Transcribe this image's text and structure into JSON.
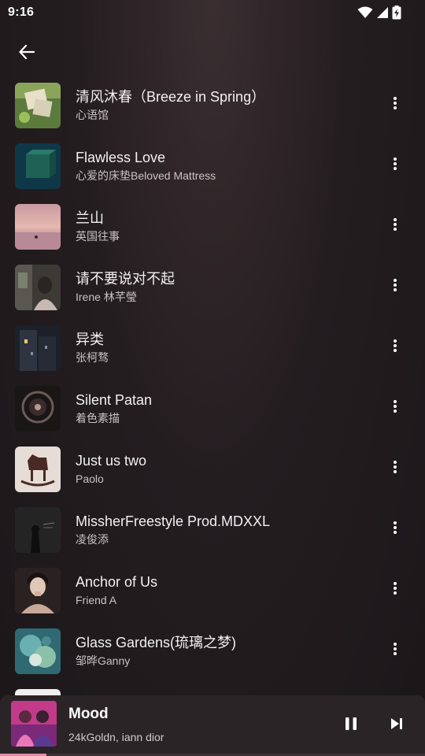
{
  "status_bar": {
    "time": "9:16"
  },
  "header": {
    "back_icon": "arrow-left-icon"
  },
  "songs": [
    {
      "title": "清风沐春（Breeze in Spring）",
      "artist": "心语馆",
      "cover": "cover-green-frames"
    },
    {
      "title": "Flawless Love",
      "artist": "心爱的床垫Beloved Mattress",
      "cover": "cover-teal-box"
    },
    {
      "title": "兰山",
      "artist": "英国往事",
      "cover": "cover-pink-sunset"
    },
    {
      "title": "请不要说对不起",
      "artist": "Irene 林芊瑩",
      "cover": "cover-girl-room"
    },
    {
      "title": "异类",
      "artist": "张柯骛",
      "cover": "cover-night-building"
    },
    {
      "title": "Silent Patan",
      "artist": "着色素描",
      "cover": "cover-dark-circle"
    },
    {
      "title": "Just us two",
      "artist": "Paolo",
      "cover": "cover-rocking-horse"
    },
    {
      "title": "MissherFreestyle Prod.MDXXL",
      "artist": "凌俊添",
      "cover": "cover-dark-figure"
    },
    {
      "title": "Anchor of Us",
      "artist": "Friend A",
      "cover": "cover-portrait"
    },
    {
      "title": "Glass Gardens(琉璃之梦)",
      "artist": "邹晔Ganny",
      "cover": "cover-glass-garden"
    },
    {
      "title": "",
      "artist": "",
      "cover": "cover-white"
    }
  ],
  "now_playing": {
    "title": "Mood",
    "artist": "24kGoldn, iann dior",
    "cover": "cover-mood-pink",
    "progress": 0.11
  },
  "colors": {
    "background": "#241d20",
    "mini_player": "#2b2427",
    "progress": "#e38aa8"
  }
}
